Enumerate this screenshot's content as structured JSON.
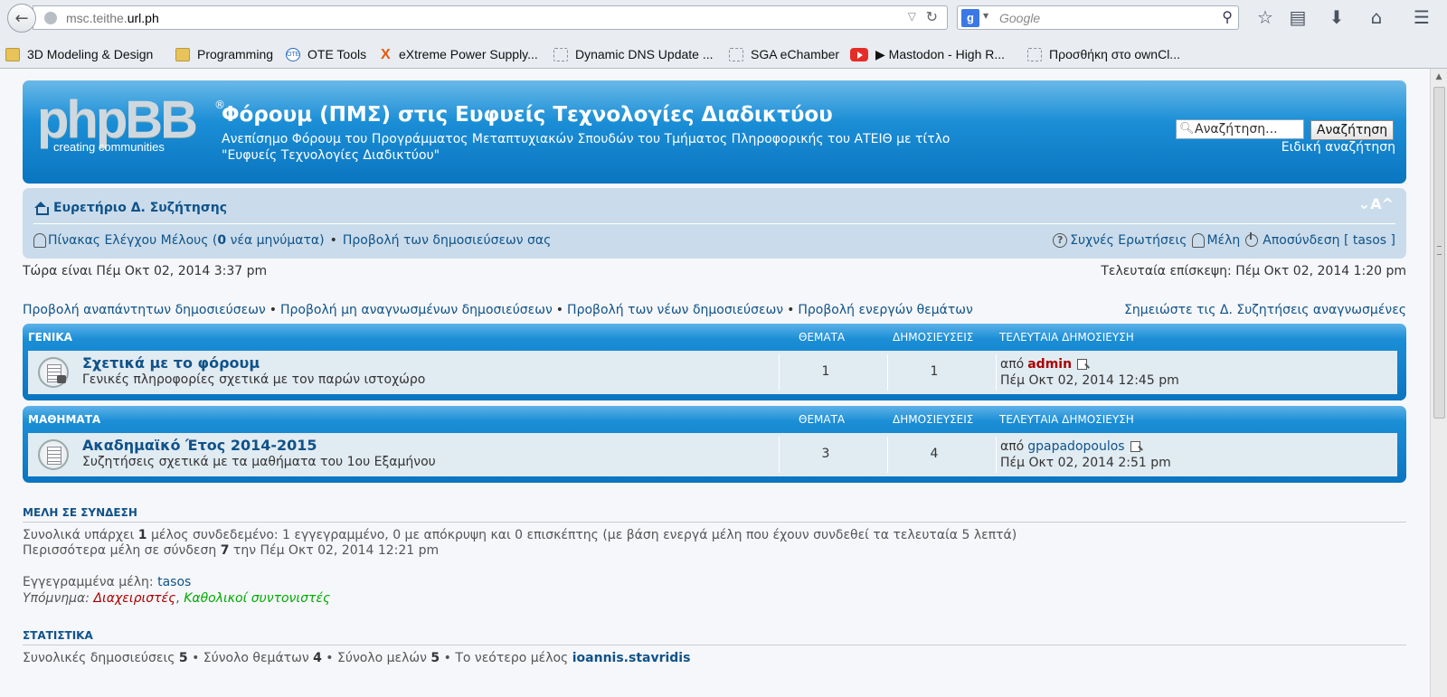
{
  "browser": {
    "url_prefix": "msc.teithe.",
    "url_domain": "url.ph",
    "search_placeholder": "Google",
    "search_engine_letter": "g",
    "bookmarks": [
      {
        "label": "3D Modeling & Design",
        "icon": "folder"
      },
      {
        "label": "Programming",
        "icon": "folder"
      },
      {
        "label": "OTE Tools",
        "icon": "ote"
      },
      {
        "label": "eXtreme Power Supply...",
        "icon": "x"
      },
      {
        "label": "Dynamic DNS Update ...",
        "icon": "dashed"
      },
      {
        "label": "SGA eChamber",
        "icon": "dashed"
      },
      {
        "label": "▶ Mastodon - High R...",
        "icon": "youtube"
      },
      {
        "label": "Προσθήκη στο ownCl...",
        "icon": "dashed"
      }
    ]
  },
  "header": {
    "logo_text": "phpBB",
    "logo_sub": "creating communities",
    "logo_reg": "®",
    "title": "Φόρουμ (ΠΜΣ) στις Ευφυείς Τεχνολογίες Διαδικτύου",
    "description": "Ανεπίσημο Φόρουμ του Προγράμματος Μεταπτυχιακών Σπουδών του Τμήματος Πληροφορικής του ΑΤΕΙΘ με τίτλο \"Ευφυείς Τεχνολογίες Διαδικτύου\"",
    "search_placeholder": "Αναζήτηση...",
    "search_button": "Αναζήτηση",
    "advanced_search": "Ειδική αναζήτηση"
  },
  "navbar": {
    "home": "Ευρετήριο Δ. Συζήτησης",
    "font_resize": "⌄A^",
    "ucp_prefix": "Πίνακας Ελέγχου Μέλους (",
    "ucp_count": "0",
    "ucp_suffix": " νέα μηνύματα)",
    "bullet": "•",
    "view_posts": "Προβολή των δημοσιεύσεων σας",
    "faq": "Συχνές Ερωτήσεις",
    "members": "Μέλη",
    "logout": "Αποσύνδεση [ tasos ]"
  },
  "times": {
    "now": "Τώρα είναι Πέμ Οκτ 02, 2014 3:37 pm",
    "last_visit": "Τελευταία επίσκεψη: Πέμ Οκτ 02, 2014 1:20 pm"
  },
  "quick_links": {
    "unanswered": "Προβολή αναπάντητων δημοσιεύσεων",
    "unread": "Προβολή μη αναγνωσμένων δημοσιεύσεων",
    "new": "Προβολή των νέων δημοσιεύσεων",
    "active": "Προβολή ενεργών θεμάτων",
    "sep": "•",
    "mark_read": "Σημειώστε τις Δ. Συζητήσεις αναγνωσμένες"
  },
  "columns": {
    "topics": "ΘΕΜΑΤΑ",
    "posts": "ΔΗΜΟΣΙΕΥΣΕΙΣ",
    "last_post": "ΤΕΛΕΥΤΑΙΑ ΔΗΜΟΣΙΕΥΣΗ"
  },
  "categories": [
    {
      "name": "ΓΕΝΙΚΑ",
      "forum": {
        "title": "Σχετικά με το φόρουμ",
        "desc": "Γενικές πληροφορίες σχετικά με τον παρών ιστοχώρο",
        "topics": "1",
        "posts": "1",
        "by": "από",
        "author": "admin",
        "date": "Πέμ Οκτ 02, 2014 12:45 pm",
        "locked": true
      }
    },
    {
      "name": "ΜΑΘΗΜΑΤΑ",
      "forum": {
        "title": "Ακαδημαϊκό Έτος 2014-2015",
        "desc": "Συζητήσεις σχετικά με τα μαθήματα του 1ου Εξαμήνου",
        "topics": "3",
        "posts": "4",
        "by": "από",
        "author": "gpapadopoulos",
        "date": "Πέμ Οκτ 02, 2014 2:51 pm",
        "locked": false
      }
    }
  ],
  "online": {
    "heading": "ΜΕΛΗ ΣΕ ΣΥΝΔΕΣΗ",
    "line1_a": "Συνολικά υπάρχει ",
    "line1_b": "1",
    "line1_c": " μέλος συνδεδεμένο: 1 εγγεγραμμένο, 0 με απόκρυψη και 0 επισκέπτης (με βάση ενεργά μέλη που έχουν συνδεθεί τα τελευταία 5 λεπτά)",
    "line2_a": "Περισσότερα μέλη σε σύνδεση ",
    "line2_b": "7",
    "line2_c": " την Πέμ Οκτ 02, 2014 12:21 pm",
    "registered_label": "Εγγεγραμμένα μέλη: ",
    "registered_user": "tasos",
    "legend_label": "Υπόμνημα: ",
    "legend_admins": "Διαχειριστές",
    "legend_comma": ", ",
    "legend_mods": "Καθολικοί συντονιστές"
  },
  "stats": {
    "heading": "ΣΤΑΤΙΣΤΙΚΑ",
    "posts_label": "Συνολικές δημοσιεύσεις ",
    "posts": "5",
    "topics_label": " • Σύνολο θεμάτων ",
    "topics": "4",
    "members_label": " • Σύνολο μελών ",
    "members": "5",
    "newest_label": " • Το νεότερο μέλος ",
    "newest": "ioannis.stavridis"
  },
  "colors": {
    "header_blue": "#0a75c0",
    "link": "#105289",
    "admin_red": "#aa0000",
    "mod_green": "#00aa00",
    "row_bg": "#e1ebf2"
  }
}
